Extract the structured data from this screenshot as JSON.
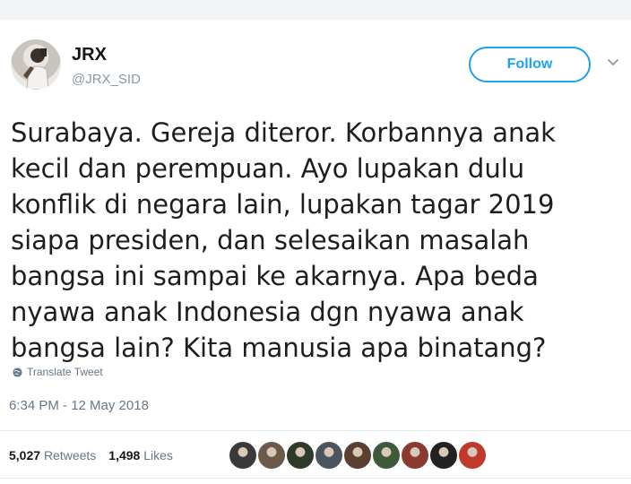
{
  "user": {
    "name": "JRX",
    "handle": "@JRX_SID"
  },
  "follow_label": "Follow",
  "tweet_lines": [
    "Surabaya. Gereja diteror. Korbannya anak",
    "kecil dan perempuan. Ayo lupakan dulu",
    "konflik di negara lain, lupakan tagar 2019",
    "siapa presiden, dan selesaikan masalah",
    "bangsa ini sampai ke akarnya. Apa beda",
    "nyawa anak Indonesia dgn nyawa anak",
    "bangsa lain? Kita manusia apa binatang?"
  ],
  "translate_label": "Translate Tweet",
  "timestamp": "6:34 PM - 12 May 2018",
  "stats": {
    "retweets_count": "5,027",
    "retweets_label": "Retweets",
    "likes_count": "1,498",
    "likes_label": "Likes"
  },
  "colors": {
    "accent": "#1da1f2",
    "secondary_text": "#657786"
  },
  "icons": {
    "translate": "globe-icon",
    "more": "chevron-down-icon"
  },
  "liker_avatar_colors": [
    "#3a3a3a",
    "#6b5a4a",
    "#2f3a2a",
    "#4a5560",
    "#5a4030",
    "#3d5a3a",
    "#8a3a30",
    "#222222",
    "#c0392b"
  ]
}
